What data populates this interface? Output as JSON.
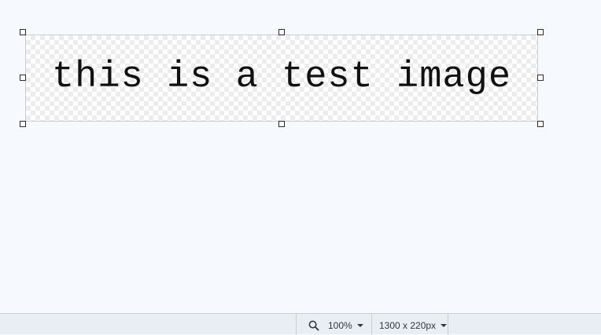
{
  "canvas": {
    "image_text": "this is a test image"
  },
  "statusbar": {
    "zoom_icon": "search-icon",
    "zoom_level": "100%",
    "canvas_size": "1300 x 220px"
  }
}
